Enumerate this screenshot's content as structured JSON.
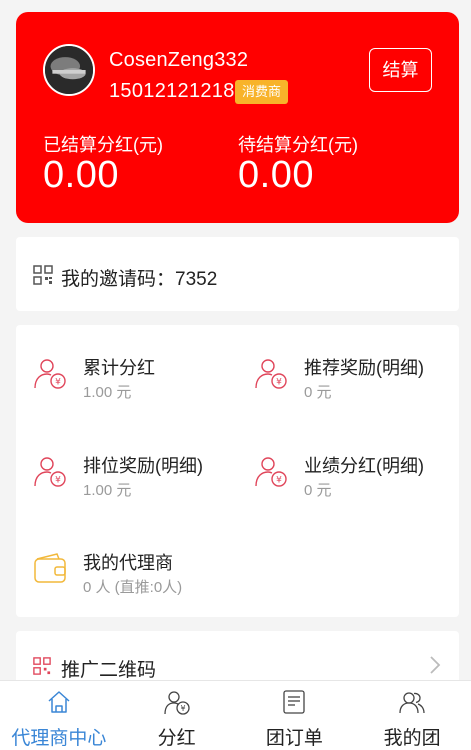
{
  "profile": {
    "username": "CosenZeng332",
    "phone": "15012121218",
    "role_badge": "消费商",
    "settle_button": "结算"
  },
  "stats": [
    {
      "label": "已结算分红(元)",
      "value": "0.00"
    },
    {
      "label": "待结算分红(元)",
      "value": "0.00"
    }
  ],
  "invite": {
    "text": "我的邀请码：7352",
    "icon": "qrcode-icon"
  },
  "grid": [
    {
      "title": "累计分红",
      "value": "1.00 元",
      "icon": "user-yuan-icon"
    },
    {
      "title": "推荐奖励(明细)",
      "value": "0 元",
      "icon": "user-yuan-icon"
    },
    {
      "title": "排位奖励(明细)",
      "value": "1.00 元",
      "icon": "user-yuan-icon"
    },
    {
      "title": "业绩分红(明细)",
      "value": "0 元",
      "icon": "user-yuan-icon"
    },
    {
      "title": "我的代理商",
      "value": "0 人  (直推:0人)",
      "icon": "wallet-icon"
    }
  ],
  "promo": {
    "text": "推广二维码",
    "icon": "qrcode-icon"
  },
  "tabbar": [
    {
      "label": "代理商中心",
      "icon": "home-icon",
      "active": true
    },
    {
      "label": "分红",
      "icon": "user-yuan-icon",
      "active": false
    },
    {
      "label": "团订单",
      "icon": "order-icon",
      "active": false
    },
    {
      "label": "我的团",
      "icon": "users-icon",
      "active": false
    }
  ],
  "colors": {
    "hero_bg": "#ff0000",
    "badge_bg": "#f8b32a",
    "accent_icon": "#e0455a",
    "wallet_icon": "#f2b83a",
    "tab_active": "#3a86d6"
  }
}
